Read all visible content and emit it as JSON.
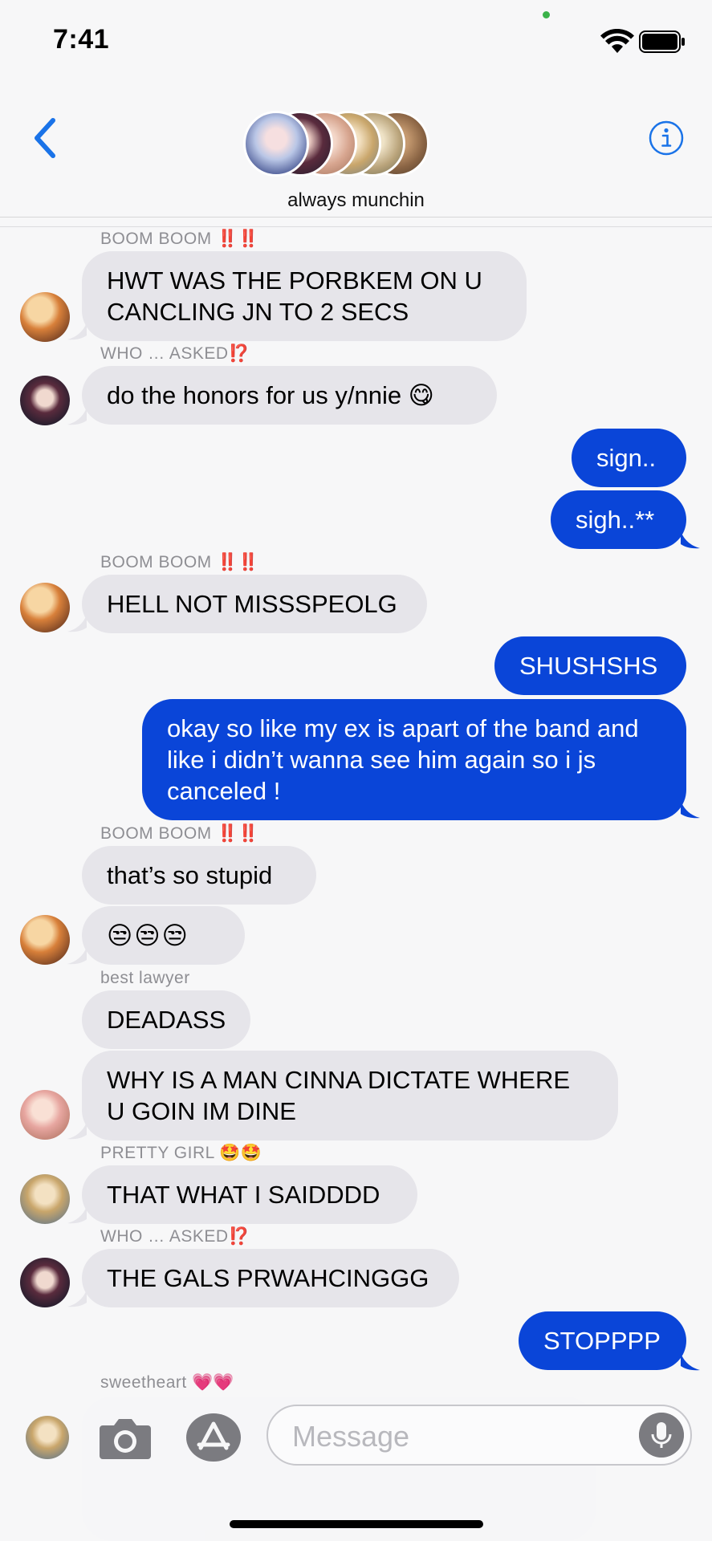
{
  "status": {
    "time": "7:41"
  },
  "header": {
    "group_name": "always munchin"
  },
  "messages": {
    "s1": {
      "name": "BOOM BOOM ",
      "mark": "‼️‼️"
    },
    "m1": "HWT WAS THE PORBKEM ON U CANCLING JN TO 2 SECS",
    "s2": {
      "name": "WHO … ASKED",
      "mark": "⁉️"
    },
    "m2": "do the honors for us y/nnie 😋",
    "m3": "sign..",
    "m4": "sigh..**",
    "s3": {
      "name": "BOOM BOOM ",
      "mark": "‼️‼️"
    },
    "m5": "HELL NOT MISSSPEOLG",
    "m6": "SHUSHSHS",
    "m7": "okay so like my ex is apart of the band and like i didn’t wanna see him again so i js canceled !",
    "s4": {
      "name": "BOOM BOOM ",
      "mark": "‼️‼️"
    },
    "m8": "that’s so stupid",
    "m9": "😒😒😒",
    "s5": {
      "name": "best lawyer"
    },
    "m10": "DEADASS",
    "m11": "WHY IS A MAN CINNA DICTATE WHERE U GOIN IM DINE",
    "s6": {
      "name": "PRETTY GIRL ",
      "mark": "🤩🤩"
    },
    "m12": "THAT WHAT I SAIDDDD",
    "s7": {
      "name": "WHO … ASKED",
      "mark": "⁉️"
    },
    "m13": "THE GALS PRWAHCINGGG",
    "m14": "STOPPPP",
    "s8": {
      "name": "sweetheart ",
      "mark": "💗💗"
    }
  },
  "composer": {
    "placeholder": "Message"
  },
  "colors": {
    "outgoing": "#0a45d8",
    "incoming": "#e6e5ea",
    "accent": "#1a73e8"
  }
}
